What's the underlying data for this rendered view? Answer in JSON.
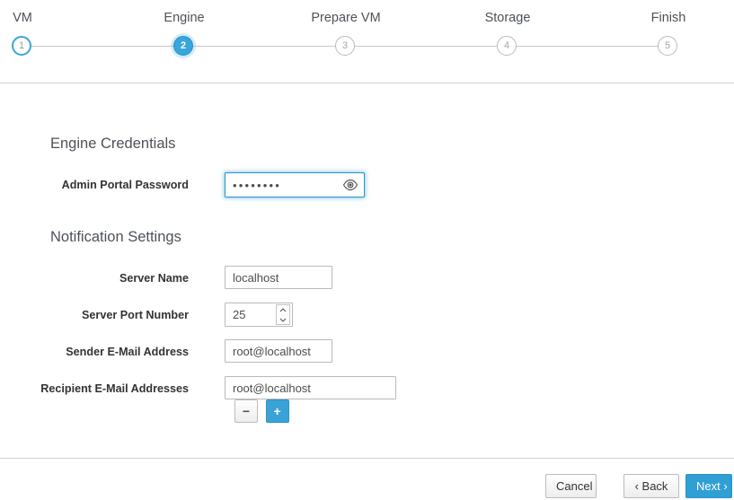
{
  "wizard": {
    "steps": [
      {
        "label": "VM",
        "number": "1",
        "state": "done"
      },
      {
        "label": "Engine",
        "number": "2",
        "state": "active"
      },
      {
        "label": "Prepare VM",
        "number": "3",
        "state": "upcoming"
      },
      {
        "label": "Storage",
        "number": "4",
        "state": "upcoming"
      },
      {
        "label": "Finish",
        "number": "5",
        "state": "upcoming"
      }
    ],
    "accent_color": "#39a5dc",
    "inactive_color": "#bbbbbb"
  },
  "engine_credentials": {
    "heading": "Engine Credentials",
    "admin_password": {
      "label": "Admin Portal Password",
      "value": "••••••••",
      "placeholder": "",
      "toggle_icon": "eye-icon",
      "focused": true
    }
  },
  "notification_settings": {
    "heading": "Notification Settings",
    "server_name": {
      "label": "Server Name",
      "value": "localhost",
      "placeholder": ""
    },
    "server_port": {
      "label": "Server Port Number",
      "value": "25",
      "placeholder": "",
      "spinner_up_icon": "chevron-up-icon",
      "spinner_down_icon": "chevron-down-icon"
    },
    "sender_email": {
      "label": "Sender E-Mail Address",
      "value": "root@localhost",
      "placeholder": ""
    },
    "recipient_emails": {
      "label": "Recipient E-Mail Addresses",
      "value": "root@localhost",
      "placeholder": "",
      "remove_glyph": "−",
      "remove_icon": "minus-icon",
      "add_glyph": "+",
      "add_icon": "plus-icon"
    }
  },
  "footer": {
    "cancel_label": "Cancel",
    "back_label": "‹ Back",
    "next_label": "Next ›"
  }
}
